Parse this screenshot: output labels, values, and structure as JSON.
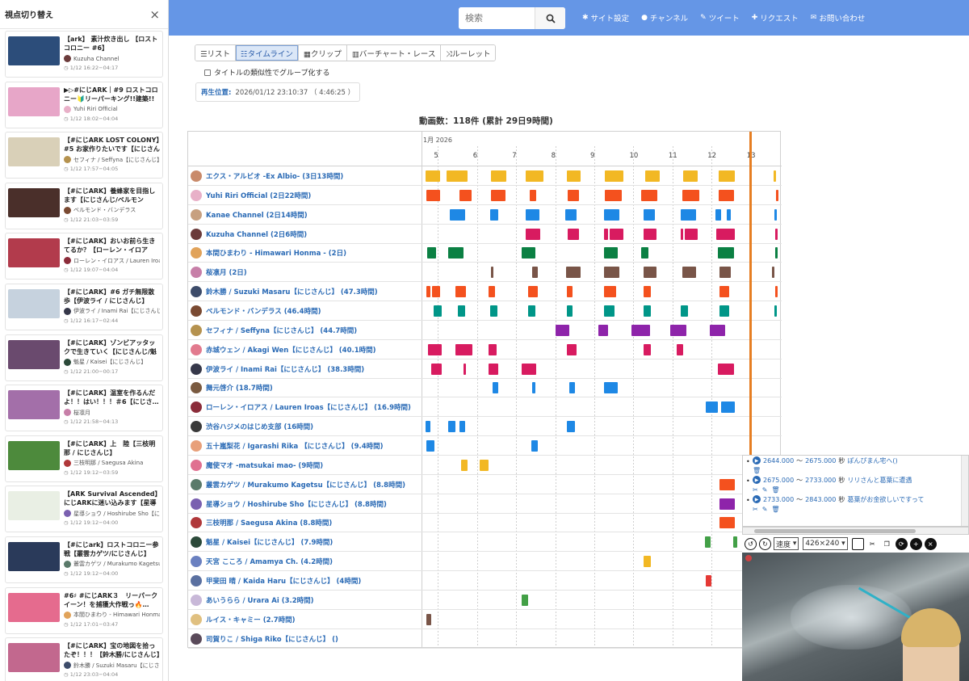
{
  "sidebar": {
    "title": "視点切り替え",
    "close": "×",
    "items": [
      {
        "title": "【ark】 素汁炊き出し 【ロストコロニー #6】",
        "channel": "Kuzuha Channel",
        "time": "1/12 16:22−04:17",
        "thumb": "#2c4d7a",
        "av": "#6b3b3b"
      },
      {
        "title": "▶▷#にじARK｜#9 ロストコロニー🔰リーパーキング!!建築!!リ…",
        "channel": "Yuhi Riri Official",
        "time": "1/12 18:02−04:04",
        "thumb": "#e7a6c8",
        "av": "#e8b0c8"
      },
      {
        "title": "【#にじARK LOST COLONY】#5 お家作りたいです【にじさんじ…",
        "channel": "セフィナ / Seffyna【にじさんじ】",
        "time": "1/12 17:57−04:05",
        "thumb": "#d9d0b8",
        "av": "#b5924f"
      },
      {
        "title": "【#にじARK】養蜂家を目指します【にじさんじ/ベルモンド・…",
        "channel": "ベルモンド・バンデラス",
        "time": "1/12 21:03−03:59",
        "thumb": "#4a2f2a",
        "av": "#7a4a32"
      },
      {
        "title": "【#にじARK】おいお前ら生きてるか？【ローレン・イロアス…",
        "channel": "ローレン・イロアス / Lauren Iroas",
        "time": "1/12 19:07−04:04",
        "thumb": "#b23b4c",
        "av": "#8b2c3a"
      },
      {
        "title": "【#にじARK】#6 ガチ無限散歩【伊波ライ / にじさんじ】",
        "channel": "伊波ライ / Inami Rai【にじさんじ】",
        "time": "1/12 16:17−02:44",
        "thumb": "#c6d2de",
        "av": "#36384a"
      },
      {
        "title": "【#にじARK】ゾンビアッタックで生きていく【にじさんじ/魁星】",
        "channel": "魁星 / Kaisei【にじさんじ】",
        "time": "1/12 21:00−00:17",
        "thumb": "#6a4a6e",
        "av": "#2c4a3a"
      },
      {
        "title": "【#にじARK】温室を作るんだよ！！はい！！！＃6【にじさ…",
        "channel": "桜凛月",
        "time": "1/12 21:58−04:13",
        "thumb": "#a36fa9",
        "av": "#c77fa8"
      },
      {
        "title": "【#にじARK】上　陸【三枝明那 / にじさんじ】",
        "channel": "三枝明那 / Saegusa Akina",
        "time": "1/12 19:12−03:59",
        "thumb": "#4d8a3c",
        "av": "#b0383a"
      },
      {
        "title": "【ARK Survival Ascended】にじARKに迷い込みます【星導ショウ…",
        "channel": "星導ショウ / Hoshirube Sho【に…",
        "time": "1/12 19:12−04:00",
        "thumb": "#e9efe4",
        "av": "#7a60b0"
      },
      {
        "title": "【#にじark】ロストコロニー参戦【叢雲カゲツ/にじさんじ】",
        "channel": "叢雲カゲツ / Murakumo Kagetsu",
        "time": "1/12 19:12−04:00",
        "thumb": "#2a3a5a",
        "av": "#5a7a6a"
      },
      {
        "title": "#6♯ #にじARK３　リーパークイーン！を捕獲大作戦っ🔥…",
        "channel": "本間ひまわり - Himawari Honma",
        "time": "1/12 17:01−03:47",
        "thumb": "#e56b8e",
        "av": "#e1a35a"
      },
      {
        "title": "【#にじARK】宝の地図を拾ったぞ！！！【鈴木勝/にじさんじ】",
        "channel": "鈴木勝 / Suzuki Masaru【にじさんじ】",
        "time": "1/12 23:03−04:04",
        "thumb": "#c2688e",
        "av": "#3d4c6a"
      }
    ]
  },
  "navbar": {
    "search_placeholder": "検索",
    "search_icon": "search-icon",
    "links": [
      {
        "icon": "gear-icon",
        "glyph": "✱",
        "label": "サイト設定"
      },
      {
        "icon": "user-icon",
        "glyph": "●",
        "label": "チャンネル"
      },
      {
        "icon": "edit-icon",
        "glyph": "✎",
        "label": "ツイート"
      },
      {
        "icon": "user-plus-icon",
        "glyph": "✚",
        "label": "リクエスト"
      },
      {
        "icon": "envelope-icon",
        "glyph": "✉",
        "label": "お問い合わせ"
      }
    ]
  },
  "main": {
    "tabs": [
      {
        "icon": "☰",
        "label": "リスト"
      },
      {
        "icon": "☷",
        "label": "タイムライン",
        "active": true
      },
      {
        "icon": "▦",
        "label": "クリップ"
      },
      {
        "icon": "▥",
        "label": "バーチャート・レース"
      },
      {
        "icon": "⤨",
        "label": "ルーレット"
      }
    ],
    "group_check": "タイトルの類似性でグループ化する",
    "play_position_label": "再生位置:",
    "play_position_value": "2026/01/12 23:10:37 （ 4:46:25 ）",
    "count_title": "動画数：118件 (累計 29日9時間)"
  },
  "timeline": {
    "month_label": "1月 2026",
    "days": [
      "5",
      "6",
      "7",
      "8",
      "9",
      "10",
      "11",
      "12",
      "13"
    ],
    "day_start": 4.6,
    "day_end": 13.75,
    "now": 12.97,
    "rows": [
      {
        "name": "エクス・アルビオ -Ex Albio- (3日13時間)",
        "color": "#f2b824",
        "av": "#c98a6a",
        "segs": [
          [
            4.68,
            5.05
          ],
          [
            5.22,
            5.75
          ],
          [
            6.35,
            6.75
          ],
          [
            7.25,
            7.7
          ],
          [
            8.3,
            8.65
          ],
          [
            9.27,
            9.75
          ],
          [
            10.3,
            10.68
          ],
          [
            11.27,
            11.65
          ],
          [
            12.18,
            12.6
          ],
          [
            13.58,
            13.62
          ]
        ]
      },
      {
        "name": "Yuhi Riri Official (2日22時間)",
        "color": "#f4511e",
        "av": "#e8b0c8",
        "segs": [
          [
            4.7,
            5.05
          ],
          [
            5.55,
            5.85
          ],
          [
            6.35,
            6.72
          ],
          [
            7.35,
            7.52
          ],
          [
            8.32,
            8.6
          ],
          [
            9.27,
            9.7
          ],
          [
            10.2,
            10.62
          ],
          [
            11.25,
            11.68
          ],
          [
            12.17,
            12.58
          ],
          [
            13.65,
            13.7
          ]
        ]
      },
      {
        "name": "Kanae Channel (2日14時間)",
        "color": "#1e88e5",
        "av": "#c7a080",
        "segs": [
          [
            5.3,
            5.7
          ],
          [
            6.33,
            6.55
          ],
          [
            7.25,
            7.6
          ],
          [
            8.25,
            8.55
          ],
          [
            9.25,
            9.65
          ],
          [
            10.25,
            10.55
          ],
          [
            11.2,
            11.6
          ],
          [
            12.1,
            12.25
          ],
          [
            12.38,
            12.5
          ],
          [
            13.6,
            13.65
          ]
        ]
      },
      {
        "name": "Kuzuha Channel (2日6時間)",
        "color": "#d81b60",
        "av": "#6b3b3b",
        "segs": [
          [
            7.25,
            7.62
          ],
          [
            8.32,
            8.6
          ],
          [
            9.25,
            9.35
          ],
          [
            9.4,
            9.75
          ],
          [
            10.25,
            10.6
          ],
          [
            11.2,
            11.28
          ],
          [
            11.32,
            11.65
          ],
          [
            12.12,
            12.6
          ],
          [
            13.62,
            13.67
          ]
        ]
      },
      {
        "name": "本間ひまわり - Himawari Honma - (2日)",
        "color": "#0b8043",
        "av": "#e1a35a",
        "segs": [
          [
            4.73,
            4.95
          ],
          [
            5.27,
            5.65
          ],
          [
            7.15,
            7.5
          ],
          [
            9.25,
            9.6
          ],
          [
            10.2,
            10.38
          ],
          [
            12.15,
            12.58
          ],
          [
            13.62,
            13.66
          ]
        ]
      },
      {
        "name": "桜凛月 (2日)",
        "color": "#795548",
        "av": "#c77fa8",
        "segs": [
          [
            6.35,
            6.4
          ],
          [
            7.4,
            7.55
          ],
          [
            8.28,
            8.65
          ],
          [
            9.25,
            9.65
          ],
          [
            10.25,
            10.6
          ],
          [
            11.25,
            11.6
          ],
          [
            12.2,
            12.5
          ],
          [
            13.55,
            13.6
          ]
        ]
      },
      {
        "name": "鈴木勝 / Suzuki Masaru【にじさんじ】 (47.3時間)",
        "color": "#f4511e",
        "av": "#3d4c6a",
        "segs": [
          [
            4.7,
            4.8
          ],
          [
            4.85,
            5.05
          ],
          [
            5.45,
            5.72
          ],
          [
            6.3,
            6.45
          ],
          [
            7.3,
            7.55
          ],
          [
            8.3,
            8.45
          ],
          [
            9.25,
            9.55
          ],
          [
            10.25,
            10.45
          ],
          [
            12.2,
            12.45
          ],
          [
            13.62,
            13.66
          ]
        ]
      },
      {
        "name": "ベルモンド・バンデラス (46.4時間)",
        "color": "#009688",
        "av": "#7a4a32",
        "segs": [
          [
            4.88,
            5.1
          ],
          [
            5.5,
            5.7
          ],
          [
            6.33,
            6.52
          ],
          [
            7.3,
            7.5
          ],
          [
            8.3,
            8.45
          ],
          [
            9.25,
            9.52
          ],
          [
            10.25,
            10.45
          ],
          [
            11.2,
            11.4
          ],
          [
            12.2,
            12.45
          ],
          [
            13.6,
            13.64
          ]
        ]
      },
      {
        "name": "セフィナ / Seffyna【にじさんじ】 (44.7時間)",
        "color": "#8e24aa",
        "av": "#b5924f",
        "segs": [
          [
            8.0,
            8.35
          ],
          [
            9.1,
            9.35
          ],
          [
            9.95,
            10.42
          ],
          [
            10.95,
            11.35
          ],
          [
            11.95,
            12.35
          ]
        ]
      },
      {
        "name": "赤城ウェン / Akagi Wen【にじさんじ】 (40.1時間)",
        "color": "#d81b60",
        "av": "#e27a8e",
        "segs": [
          [
            4.75,
            5.1
          ],
          [
            5.45,
            5.88
          ],
          [
            6.3,
            6.5
          ],
          [
            8.3,
            8.55
          ],
          [
            10.25,
            10.45
          ],
          [
            11.1,
            11.28
          ]
        ]
      },
      {
        "name": "伊波ライ / Inami Rai【にじさんじ】 (38.3時間)",
        "color": "#d81b60",
        "av": "#36384a",
        "segs": [
          [
            4.82,
            5.1
          ],
          [
            5.65,
            5.72
          ],
          [
            6.3,
            6.55
          ],
          [
            7.15,
            7.52
          ],
          [
            12.15,
            12.58
          ]
        ]
      },
      {
        "name": "舞元啓介 (18.7時間)",
        "color": "#1e88e5",
        "av": "#7a5a40",
        "segs": [
          [
            6.4,
            6.55
          ],
          [
            7.4,
            7.5
          ],
          [
            8.35,
            8.5
          ],
          [
            9.25,
            9.6
          ]
        ]
      },
      {
        "name": "ローレン・イロアス / Lauren Iroas【にじさんじ】 (16.9時間)",
        "color": "#1e88e5",
        "av": "#8b2c3a",
        "segs": [
          [
            11.85,
            12.15
          ],
          [
            12.25,
            12.6
          ]
        ]
      },
      {
        "name": "渋谷ハジメのはじめ支部 (16時間)",
        "color": "#1e88e5",
        "av": "#3a3a3a",
        "segs": [
          [
            4.68,
            4.8
          ],
          [
            5.27,
            5.45
          ],
          [
            5.55,
            5.7
          ],
          [
            8.3,
            8.5
          ]
        ]
      },
      {
        "name": "五十嵐梨花 / Igarashi Rika 【にじさんじ】 (9.4時間)",
        "color": "#1e88e5",
        "av": "#e8a07a",
        "segs": [
          [
            4.7,
            4.9
          ],
          [
            7.38,
            7.55
          ]
        ]
      },
      {
        "name": "魔使マオ -matsukai mao- (9時間)",
        "color": "#f2b824",
        "av": "#e07090",
        "segs": [
          [
            5.6,
            5.75
          ],
          [
            6.07,
            6.3
          ]
        ]
      },
      {
        "name": "叢雲カゲツ / Murakumo Kagetsu【にじさんじ】 (8.8時間)",
        "color": "#f4511e",
        "av": "#5a7a6a",
        "segs": [
          [
            12.2,
            12.6
          ]
        ]
      },
      {
        "name": "星導ショウ / Hoshirube Sho【にじさんじ】 (8.8時間)",
        "color": "#8e24aa",
        "av": "#7a60b0",
        "segs": [
          [
            12.2,
            12.6
          ]
        ]
      },
      {
        "name": "三枝明那 / Saegusa Akina (8.8時間)",
        "color": "#f4511e",
        "av": "#b0383a",
        "segs": [
          [
            12.2,
            12.6
          ]
        ]
      },
      {
        "name": "魁星 / Kaisei【にじさんじ】 (7.9時間)",
        "color": "#43a047",
        "av": "#2c4a3a",
        "segs": [
          [
            11.82,
            11.98
          ],
          [
            12.55,
            12.65
          ]
        ]
      },
      {
        "name": "天宮 こころ / Amamya Ch. (4.2時間)",
        "color": "#f2b824",
        "av": "#6a80c0",
        "segs": [
          [
            10.25,
            10.45
          ]
        ]
      },
      {
        "name": "甲斐田 晴 / Kaida Haru【にじさんじ】 (4時間)",
        "color": "#e53935",
        "av": "#5a70a0",
        "segs": [
          [
            11.85,
            12.0
          ]
        ]
      },
      {
        "name": "あいうらら / Urara Ai (3.2時間)",
        "color": "#43a047",
        "av": "#c8b8d8",
        "segs": [
          [
            7.15,
            7.3
          ]
        ]
      },
      {
        "name": "ルイス・キャミー (2.7時間)",
        "color": "#795548",
        "av": "#e0c080",
        "segs": [
          [
            4.7,
            4.82
          ]
        ]
      },
      {
        "name": "司賀りこ / Shiga Riko【にじさんじ】 ()",
        "color": "#f4511e",
        "av": "#5a4a5a",
        "segs": []
      }
    ]
  },
  "player": {
    "items": [
      {
        "start": "2644.000",
        "end": "2675.000",
        "label": "ぽんぴまん宅へ()"
      },
      {
        "start": "2675.000",
        "end": "2733.000",
        "label": "リリさんと葛葉に遭遇"
      },
      {
        "start": "2733.000",
        "end": "2843.000",
        "label": "葛葉がお金欲しいですって"
      }
    ],
    "tilde": "〜",
    "sec_unit": "秒",
    "speed_label": "速度",
    "resolution": "426×240",
    "video_bg": "#5a6266"
  }
}
